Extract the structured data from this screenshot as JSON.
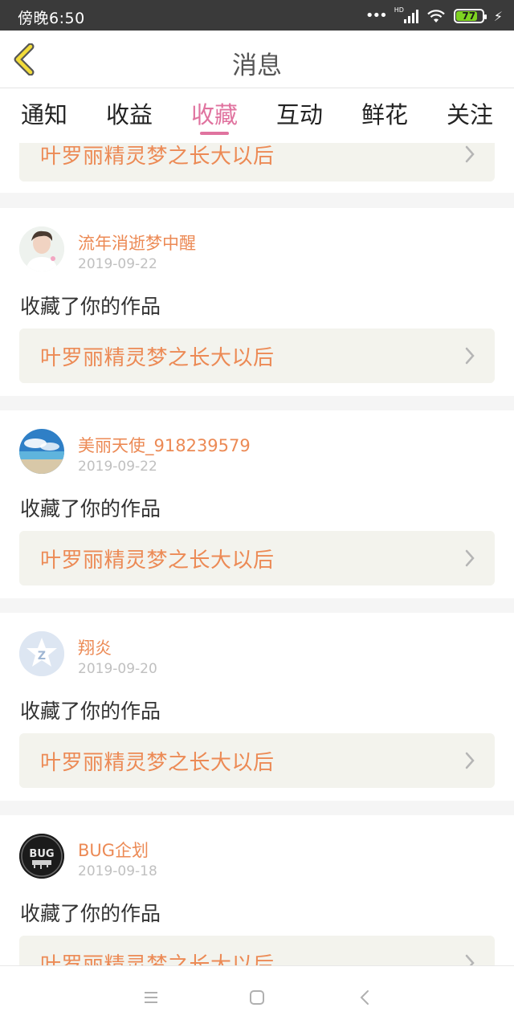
{
  "status_bar": {
    "time": "傍晚6:50",
    "network": "HD",
    "battery": "77"
  },
  "header": {
    "title": "消息",
    "back_icon": "chevron-left-icon"
  },
  "tabs": [
    {
      "label": "通知",
      "active": false
    },
    {
      "label": "收益",
      "active": false
    },
    {
      "label": "收藏",
      "active": true
    },
    {
      "label": "互动",
      "active": false
    },
    {
      "label": "鲜花",
      "active": false
    },
    {
      "label": "关注",
      "active": false
    }
  ],
  "partial_top_work": "叶罗丽精灵梦之长大以后",
  "notifications": [
    {
      "username": "流年消逝梦中醒",
      "date": "2019-09-22",
      "action": "收藏了你的作品",
      "work": "叶罗丽精灵梦之长大以后",
      "avatar": "avatar-portrait"
    },
    {
      "username": "美丽天使_918239579",
      "date": "2019-09-22",
      "action": "收藏了你的作品",
      "work": "叶罗丽精灵梦之长大以后",
      "avatar": "avatar-beach"
    },
    {
      "username": "翔炎",
      "date": "2019-09-20",
      "action": "收藏了你的作品",
      "work": "叶罗丽精灵梦之长大以后",
      "avatar": "avatar-default-z"
    },
    {
      "username": "BUG企划",
      "date": "2019-09-18",
      "action": "收藏了你的作品",
      "work": "叶罗丽精灵梦之长大以后",
      "avatar": "avatar-bug-logo",
      "avatar_text": "BUG"
    }
  ],
  "nav_bar": {
    "menu_icon": "menu-icon",
    "home_icon": "home-icon",
    "back_icon": "back-icon"
  },
  "colors": {
    "accent_pink": "#e0739f",
    "orange_text": "#ec8a55",
    "work_bar_bg": "#f3f3ed"
  }
}
